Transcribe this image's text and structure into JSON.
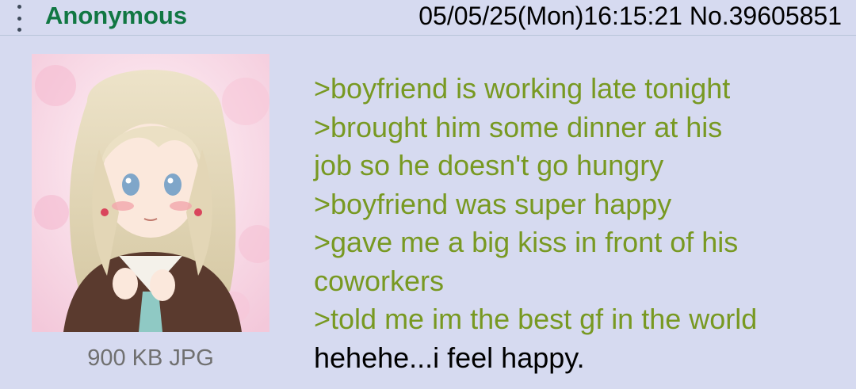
{
  "header": {
    "menu_icon": "kebab-menu-icon",
    "name": "Anonymous",
    "datetime": "05/05/25(Mon)16:15:21",
    "post_number": "No.39605851"
  },
  "file": {
    "info": "900 KB JPG",
    "thumbnail_icon": "anime-girl-thumbnail"
  },
  "comment": {
    "lines": [
      ">boyfriend is working late tonight",
      ">brought him some dinner at his",
      "job so he doesn't go hungry",
      ">boyfriend was super happy",
      ">gave me a big kiss in front of his",
      "coworkers",
      ">told me im the best gf in the world",
      "hehehe...i feel happy."
    ]
  },
  "colors": {
    "background": "#d6daf0",
    "name": "#117743",
    "greentext": "#789922",
    "file_info": "#707070"
  }
}
